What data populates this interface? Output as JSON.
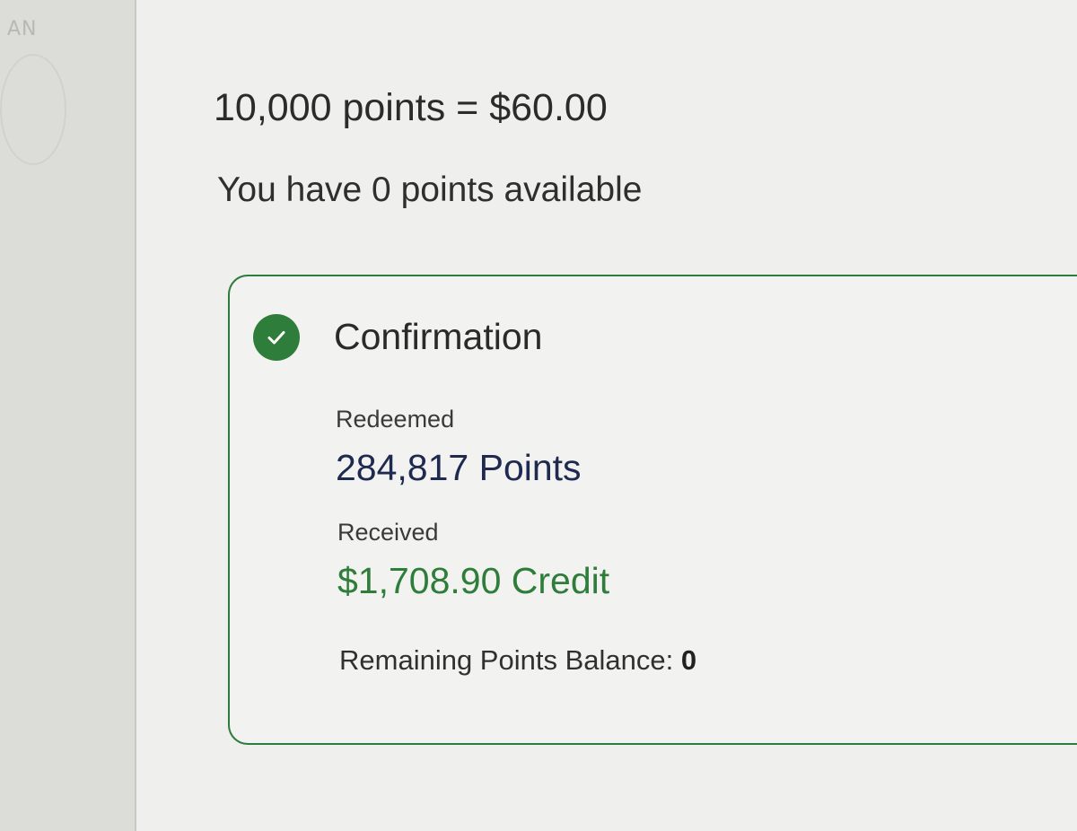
{
  "left_rail": {
    "mark_text": "AN"
  },
  "rate": {
    "text": "10,000 points = $60.00"
  },
  "availability": {
    "text": "You have 0 points available"
  },
  "confirmation": {
    "title": "Confirmation",
    "icon": "check-circle-icon",
    "redeemed_label": "Redeemed",
    "redeemed_value": "284,817 Points",
    "received_label": "Received",
    "received_value": "$1,708.90 Credit",
    "remaining_label": "Remaining Points Balance: ",
    "remaining_value": "0"
  },
  "colors": {
    "accent_green": "#2e7d3a",
    "navy_text": "#1e2a4f",
    "card_border": "#2f7a3d"
  }
}
